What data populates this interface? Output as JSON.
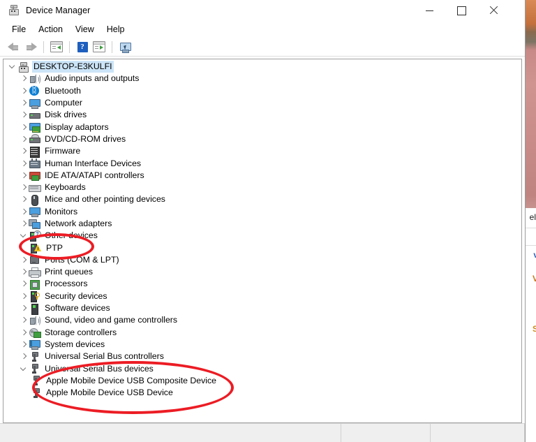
{
  "window": {
    "title": "Device Manager",
    "title_icon": "device-manager-icon",
    "controls": {
      "minimize": "minimize-icon",
      "maximize": "maximize-icon",
      "close": "close-icon"
    }
  },
  "menubar": {
    "items": [
      {
        "label": "File"
      },
      {
        "label": "Action"
      },
      {
        "label": "View"
      },
      {
        "label": "Help"
      }
    ]
  },
  "toolbar": {
    "buttons": [
      {
        "icon": "back-arrow-icon",
        "label": "Back"
      },
      {
        "icon": "forward-arrow-icon",
        "label": "Forward"
      },
      {
        "icon": "properties-icon",
        "label": "Properties"
      },
      {
        "icon": "help-icon",
        "label": "Help"
      },
      {
        "icon": "update-driver-icon",
        "label": "Update driver"
      },
      {
        "icon": "scan-hardware-icon",
        "label": "Scan for hardware changes"
      }
    ]
  },
  "tree": {
    "root": {
      "label": "DESKTOP-E3KULFI",
      "icon": "computer-root-icon",
      "expanded": true,
      "selected": true
    },
    "nodes": [
      {
        "label": "Audio inputs and outputs",
        "icon": "speaker-icon",
        "level": 1,
        "state": "collapsed"
      },
      {
        "label": "Bluetooth",
        "icon": "bluetooth-icon",
        "level": 1,
        "state": "collapsed"
      },
      {
        "label": "Computer",
        "icon": "monitor-icon",
        "level": 1,
        "state": "collapsed"
      },
      {
        "label": "Disk drives",
        "icon": "disk-drive-icon",
        "level": 1,
        "state": "collapsed"
      },
      {
        "label": "Display adaptors",
        "icon": "display-adapter-icon",
        "level": 1,
        "state": "collapsed"
      },
      {
        "label": "DVD/CD-ROM drives",
        "icon": "dvd-drive-icon",
        "level": 1,
        "state": "collapsed"
      },
      {
        "label": "Firmware",
        "icon": "firmware-icon",
        "level": 1,
        "state": "collapsed"
      },
      {
        "label": "Human Interface Devices",
        "icon": "hid-icon",
        "level": 1,
        "state": "collapsed"
      },
      {
        "label": "IDE ATA/ATAPI controllers",
        "icon": "ide-controller-icon",
        "level": 1,
        "state": "collapsed"
      },
      {
        "label": "Keyboards",
        "icon": "keyboard-icon",
        "level": 1,
        "state": "collapsed"
      },
      {
        "label": "Mice and other pointing devices",
        "icon": "mouse-icon",
        "level": 1,
        "state": "collapsed"
      },
      {
        "label": "Monitors",
        "icon": "monitor-icon",
        "level": 1,
        "state": "collapsed"
      },
      {
        "label": "Network adapters",
        "icon": "network-adapter-icon",
        "level": 1,
        "state": "collapsed"
      },
      {
        "label": "Other devices",
        "icon": "other-devices-icon",
        "level": 1,
        "state": "expanded"
      },
      {
        "label": "PTP",
        "icon": "unknown-device-warning-icon",
        "level": 2,
        "state": "leaf",
        "has_warning": true
      },
      {
        "label": "Ports (COM & LPT)",
        "icon": "port-icon",
        "level": 1,
        "state": "collapsed"
      },
      {
        "label": "Print queues",
        "icon": "printer-icon",
        "level": 1,
        "state": "collapsed"
      },
      {
        "label": "Processors",
        "icon": "processor-icon",
        "level": 1,
        "state": "collapsed"
      },
      {
        "label": "Security devices",
        "icon": "security-device-icon",
        "level": 1,
        "state": "collapsed"
      },
      {
        "label": "Software devices",
        "icon": "software-device-icon",
        "level": 1,
        "state": "collapsed"
      },
      {
        "label": "Sound, video and game controllers",
        "icon": "speaker-icon",
        "level": 1,
        "state": "collapsed"
      },
      {
        "label": "Storage controllers",
        "icon": "storage-controller-icon",
        "level": 1,
        "state": "collapsed"
      },
      {
        "label": "System devices",
        "icon": "system-device-icon",
        "level": 1,
        "state": "collapsed"
      },
      {
        "label": "Universal Serial Bus controllers",
        "icon": "usb-icon",
        "level": 1,
        "state": "collapsed"
      },
      {
        "label": "Universal Serial Bus devices",
        "icon": "usb-icon",
        "level": 1,
        "state": "expanded"
      },
      {
        "label": "Apple Mobile Device USB Composite Device",
        "icon": "usb-icon",
        "level": 2,
        "state": "leaf"
      },
      {
        "label": "Apple Mobile Device USB Device",
        "icon": "usb-icon",
        "level": 2,
        "state": "leaf"
      }
    ]
  },
  "annotations": {
    "color": "#ec1c24",
    "shapes": [
      {
        "name": "ptp-highlight",
        "type": "ellipse",
        "targets": "PTP"
      },
      {
        "name": "usb-devices-highlight",
        "type": "ellipse",
        "targets": "Apple Mobile Device USB Composite Device, Apple Mobile Device USB Device"
      }
    ]
  },
  "statusbar": {
    "main": "",
    "middle": "",
    "right": ""
  },
  "background_window": {
    "title_fragment": "el",
    "links": [
      {
        "text": "v",
        "color": "#2f5fb5"
      },
      {
        "text": "V",
        "color": "#c87820"
      },
      {
        "text": "S",
        "color": "#d08a20"
      }
    ]
  }
}
